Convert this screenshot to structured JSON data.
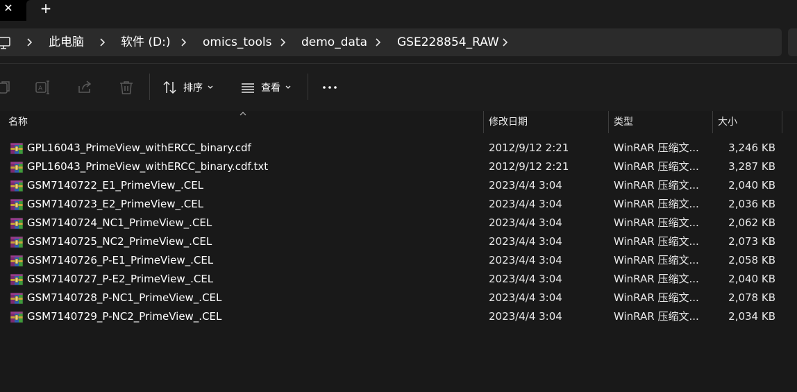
{
  "tabbar": {
    "close_glyph": "✕",
    "new_tab_glyph": "+"
  },
  "breadcrumb": {
    "items": [
      "此电脑",
      "软件 (D:)",
      "omics_tools",
      "demo_data",
      "GSE228854_RAW"
    ],
    "leading_icon": "this-pc-icon",
    "separator_icon": "chevron-right-icon"
  },
  "toolbar": {
    "icons": [
      "copy-icon",
      "rename-icon",
      "share-icon",
      "delete-icon"
    ],
    "sort_label": "排序",
    "view_label": "查看",
    "more_icon": "more-icon"
  },
  "columns": {
    "name": "名称",
    "date": "修改日期",
    "type": "类型",
    "size": "大小"
  },
  "files": [
    {
      "name": "GPL16043_PrimeView_withERCC_binary.cdf",
      "date": "2012/9/12 2:21",
      "type": "WinRAR 压缩文...",
      "size": "3,246 KB"
    },
    {
      "name": "GPL16043_PrimeView_withERCC_binary.cdf.txt",
      "date": "2012/9/12 2:21",
      "type": "WinRAR 压缩文...",
      "size": "3,287 KB"
    },
    {
      "name": "GSM7140722_E1_PrimeView_.CEL",
      "date": "2023/4/4 3:04",
      "type": "WinRAR 压缩文...",
      "size": "2,040 KB"
    },
    {
      "name": "GSM7140723_E2_PrimeView_.CEL",
      "date": "2023/4/4 3:04",
      "type": "WinRAR 压缩文...",
      "size": "2,036 KB"
    },
    {
      "name": "GSM7140724_NC1_PrimeView_.CEL",
      "date": "2023/4/4 3:04",
      "type": "WinRAR 压缩文...",
      "size": "2,062 KB"
    },
    {
      "name": "GSM7140725_NC2_PrimeView_.CEL",
      "date": "2023/4/4 3:04",
      "type": "WinRAR 压缩文...",
      "size": "2,073 KB"
    },
    {
      "name": "GSM7140726_P-E1_PrimeView_.CEL",
      "date": "2023/4/4 3:04",
      "type": "WinRAR 压缩文...",
      "size": "2,058 KB"
    },
    {
      "name": "GSM7140727_P-E2_PrimeView_.CEL",
      "date": "2023/4/4 3:04",
      "type": "WinRAR 压缩文...",
      "size": "2,040 KB"
    },
    {
      "name": "GSM7140728_P-NC1_PrimeView_.CEL",
      "date": "2023/4/4 3:04",
      "type": "WinRAR 压缩文...",
      "size": "2,078 KB"
    },
    {
      "name": "GSM7140729_P-NC2_PrimeView_.CEL",
      "date": "2023/4/4 3:04",
      "type": "WinRAR 压缩文...",
      "size": "2,034 KB"
    }
  ],
  "colors": {
    "background": "#191919",
    "tabbar": "#000000",
    "breadcrumb_bg": "#2b2b2b",
    "text": "#ffffff",
    "disabled_icon": "#5a5a5a"
  }
}
